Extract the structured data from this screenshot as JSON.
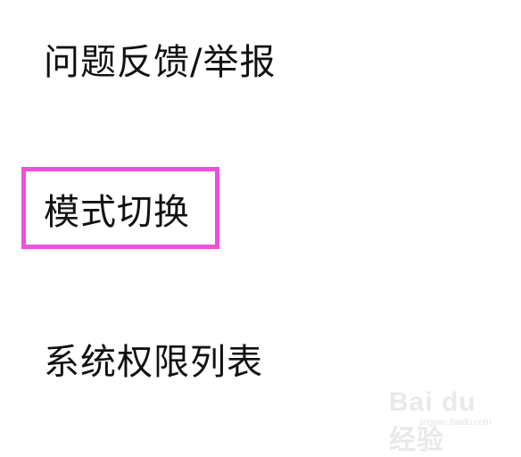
{
  "menu": {
    "items": [
      {
        "label": "问题反馈/举报"
      },
      {
        "label": "模式切换"
      },
      {
        "label": "系统权限列表"
      }
    ]
  },
  "watermark": {
    "logo_text": "Bai du 经验",
    "sub_text": "jingyan.baidu.com"
  },
  "colors": {
    "highlight_border": "#ee4fdb",
    "text": "#111111",
    "background": "#ffffff"
  }
}
